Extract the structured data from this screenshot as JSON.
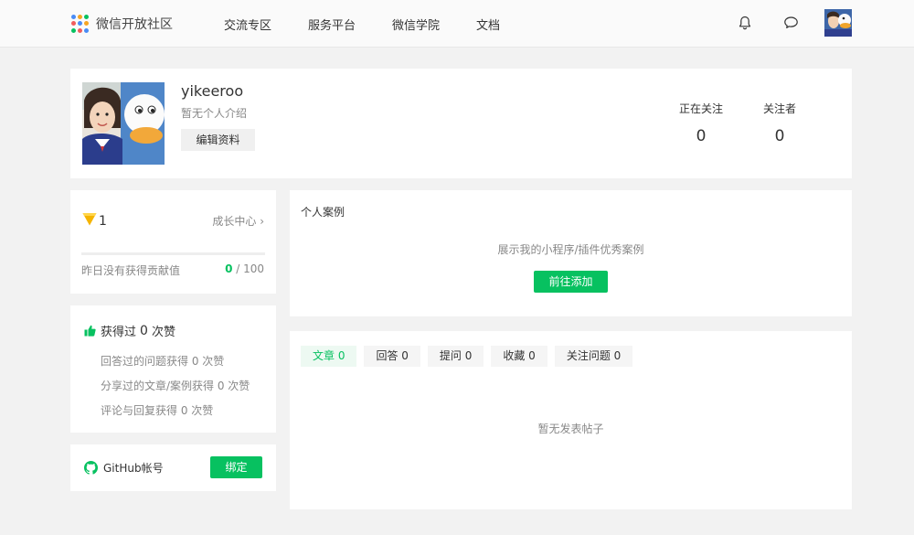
{
  "header": {
    "brand": "微信开放社区",
    "nav": [
      "交流专区",
      "服务平台",
      "微信学院",
      "文档"
    ],
    "logo_dot_colors": [
      "#4a8cf6",
      "#f6a623",
      "#07c160",
      "#f25c5c",
      "#4a8cf6",
      "#f6a623",
      "#07c160",
      "#f25c5c",
      "#4a8cf6"
    ]
  },
  "profile": {
    "username": "yikeeroo",
    "bio": "暂无个人介绍",
    "edit_label": "编辑资料",
    "following_label": "正在关注",
    "following_value": "0",
    "followers_label": "关注者",
    "followers_value": "0"
  },
  "growth": {
    "level": "1",
    "link": "成长中心",
    "link_chevron": "›",
    "contrib_label": "昨日没有获得贡献值",
    "contrib_current": "0",
    "contrib_total": " / 100",
    "progress_fraction": 0
  },
  "likes": {
    "title_prefix": "获得过",
    "count": "0",
    "title_suffix": "次赞",
    "rows": [
      "回答过的问题获得 0 次赞",
      "分享过的文章/案例获得 0 次赞",
      "评论与回复获得 0 次赞"
    ]
  },
  "github": {
    "label": "GitHub帐号",
    "bind_label": "绑定"
  },
  "cases": {
    "title": "个人案例",
    "desc": "展示我的小程序/插件优秀案例",
    "add_label": "前往添加"
  },
  "posts": {
    "tabs": [
      "文章 0",
      "回答 0",
      "提问 0",
      "收藏 0",
      "关注问题 0"
    ],
    "active_tab": 0,
    "empty": "暂无发表帖子"
  },
  "colors": {
    "accent": "#07c160",
    "level_badge": "#f5b400"
  },
  "icons": {
    "bell": "bell-icon",
    "chat": "chat-icon",
    "thumb": "thumbs-up-icon",
    "github": "github-icon",
    "level": "level-badge-icon"
  }
}
